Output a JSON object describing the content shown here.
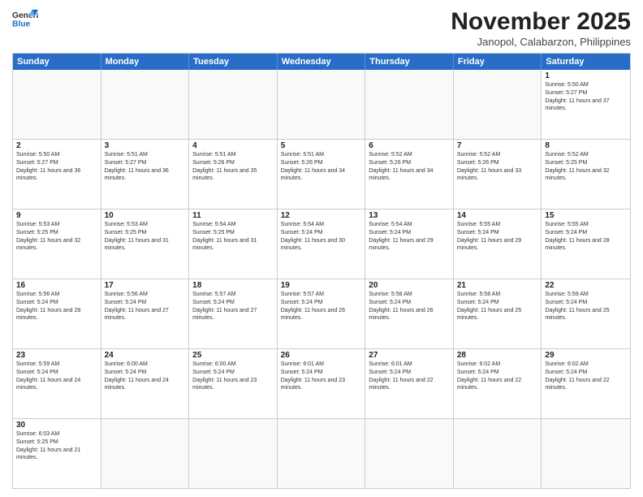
{
  "logo": {
    "line1": "General",
    "line2": "Blue"
  },
  "title": "November 2025",
  "location": "Janopol, Calabarzon, Philippines",
  "header_days": [
    "Sunday",
    "Monday",
    "Tuesday",
    "Wednesday",
    "Thursday",
    "Friday",
    "Saturday"
  ],
  "weeks": [
    [
      {
        "day": "",
        "empty": true
      },
      {
        "day": "",
        "empty": true
      },
      {
        "day": "",
        "empty": true
      },
      {
        "day": "",
        "empty": true
      },
      {
        "day": "",
        "empty": true
      },
      {
        "day": "",
        "empty": true
      },
      {
        "day": "1",
        "sunrise": "5:50 AM",
        "sunset": "5:27 PM",
        "daylight": "11 hours and 37 minutes."
      }
    ],
    [
      {
        "day": "2",
        "sunrise": "5:50 AM",
        "sunset": "5:27 PM",
        "daylight": "11 hours and 36 minutes."
      },
      {
        "day": "3",
        "sunrise": "5:51 AM",
        "sunset": "5:27 PM",
        "daylight": "11 hours and 36 minutes."
      },
      {
        "day": "4",
        "sunrise": "5:51 AM",
        "sunset": "5:26 PM",
        "daylight": "11 hours and 35 minutes."
      },
      {
        "day": "5",
        "sunrise": "5:51 AM",
        "sunset": "5:26 PM",
        "daylight": "11 hours and 34 minutes."
      },
      {
        "day": "6",
        "sunrise": "5:52 AM",
        "sunset": "5:26 PM",
        "daylight": "11 hours and 34 minutes."
      },
      {
        "day": "7",
        "sunrise": "5:52 AM",
        "sunset": "5:26 PM",
        "daylight": "11 hours and 33 minutes."
      },
      {
        "day": "8",
        "sunrise": "5:52 AM",
        "sunset": "5:25 PM",
        "daylight": "11 hours and 32 minutes."
      }
    ],
    [
      {
        "day": "9",
        "sunrise": "5:53 AM",
        "sunset": "5:25 PM",
        "daylight": "11 hours and 32 minutes."
      },
      {
        "day": "10",
        "sunrise": "5:53 AM",
        "sunset": "5:25 PM",
        "daylight": "11 hours and 31 minutes."
      },
      {
        "day": "11",
        "sunrise": "5:54 AM",
        "sunset": "5:25 PM",
        "daylight": "11 hours and 31 minutes."
      },
      {
        "day": "12",
        "sunrise": "5:54 AM",
        "sunset": "5:24 PM",
        "daylight": "11 hours and 30 minutes."
      },
      {
        "day": "13",
        "sunrise": "5:54 AM",
        "sunset": "5:24 PM",
        "daylight": "11 hours and 29 minutes."
      },
      {
        "day": "14",
        "sunrise": "5:55 AM",
        "sunset": "5:24 PM",
        "daylight": "11 hours and 29 minutes."
      },
      {
        "day": "15",
        "sunrise": "5:55 AM",
        "sunset": "5:24 PM",
        "daylight": "11 hours and 28 minutes."
      }
    ],
    [
      {
        "day": "16",
        "sunrise": "5:56 AM",
        "sunset": "5:24 PM",
        "daylight": "11 hours and 28 minutes."
      },
      {
        "day": "17",
        "sunrise": "5:56 AM",
        "sunset": "5:24 PM",
        "daylight": "11 hours and 27 minutes."
      },
      {
        "day": "18",
        "sunrise": "5:57 AM",
        "sunset": "5:24 PM",
        "daylight": "11 hours and 27 minutes."
      },
      {
        "day": "19",
        "sunrise": "5:57 AM",
        "sunset": "5:24 PM",
        "daylight": "11 hours and 26 minutes."
      },
      {
        "day": "20",
        "sunrise": "5:58 AM",
        "sunset": "5:24 PM",
        "daylight": "11 hours and 26 minutes."
      },
      {
        "day": "21",
        "sunrise": "5:58 AM",
        "sunset": "5:24 PM",
        "daylight": "11 hours and 25 minutes."
      },
      {
        "day": "22",
        "sunrise": "5:59 AM",
        "sunset": "5:24 PM",
        "daylight": "11 hours and 25 minutes."
      }
    ],
    [
      {
        "day": "23",
        "sunrise": "5:59 AM",
        "sunset": "5:24 PM",
        "daylight": "11 hours and 24 minutes."
      },
      {
        "day": "24",
        "sunrise": "6:00 AM",
        "sunset": "5:24 PM",
        "daylight": "11 hours and 24 minutes."
      },
      {
        "day": "25",
        "sunrise": "6:00 AM",
        "sunset": "5:24 PM",
        "daylight": "11 hours and 23 minutes."
      },
      {
        "day": "26",
        "sunrise": "6:01 AM",
        "sunset": "5:24 PM",
        "daylight": "11 hours and 23 minutes."
      },
      {
        "day": "27",
        "sunrise": "6:01 AM",
        "sunset": "5:24 PM",
        "daylight": "11 hours and 22 minutes."
      },
      {
        "day": "28",
        "sunrise": "6:02 AM",
        "sunset": "5:24 PM",
        "daylight": "11 hours and 22 minutes."
      },
      {
        "day": "29",
        "sunrise": "6:02 AM",
        "sunset": "5:24 PM",
        "daylight": "11 hours and 22 minutes."
      }
    ],
    [
      {
        "day": "30",
        "sunrise": "6:03 AM",
        "sunset": "5:25 PM",
        "daylight": "11 hours and 21 minutes."
      },
      {
        "day": "",
        "empty": true
      },
      {
        "day": "",
        "empty": true
      },
      {
        "day": "",
        "empty": true
      },
      {
        "day": "",
        "empty": true
      },
      {
        "day": "",
        "empty": true
      },
      {
        "day": "",
        "empty": true
      }
    ]
  ]
}
